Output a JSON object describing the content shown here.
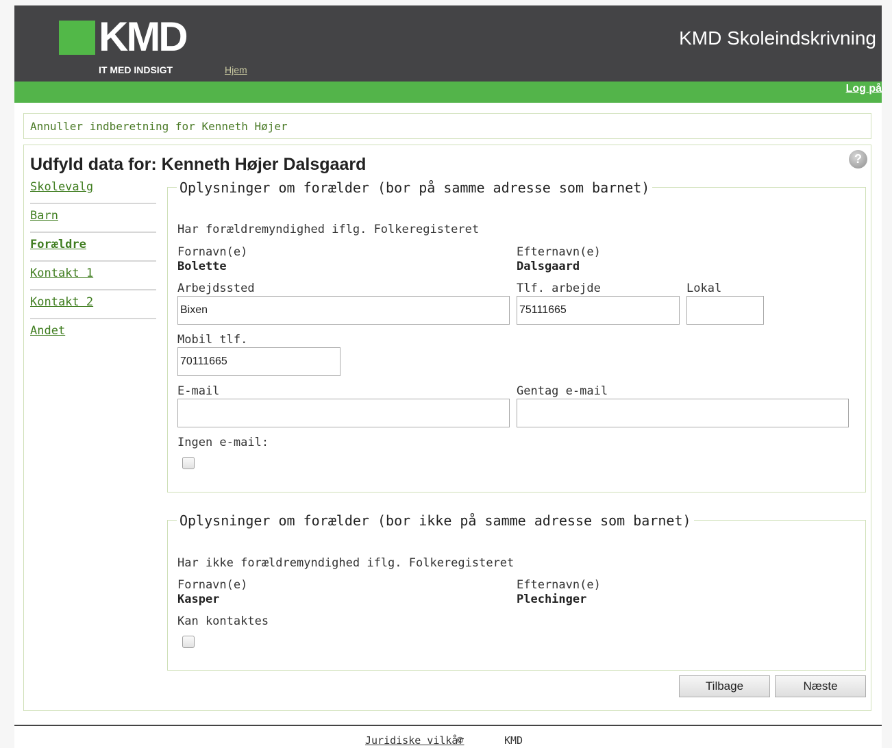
{
  "header": {
    "logo_text": "KMD",
    "tagline": "IT MED INDSIGT",
    "home_link": "Hjem",
    "app_title": "KMD Skoleindskrivning",
    "login_link": "Log på"
  },
  "cancel_link": "Annuller indberetning for Kenneth Højer",
  "page_title": "Udfyld data for: Kenneth Højer Dalsgaard",
  "help_icon": "?",
  "sidebar": {
    "items": [
      {
        "label": "Skolevalg"
      },
      {
        "label": "Barn"
      },
      {
        "label": "Forældre",
        "active": true
      },
      {
        "label": "Kontakt 1"
      },
      {
        "label": "Kontakt 2"
      },
      {
        "label": "Andet"
      }
    ]
  },
  "parent1": {
    "legend": "Oplysninger om forælder (bor på samme adresse som barnet)",
    "custody_text": "Har forældremyndighed iflg. Folkeregisteret",
    "first_name_label": "Fornavn(e)",
    "first_name": "Bolette",
    "last_name_label": "Efternavn(e)",
    "last_name": "Dalsgaard",
    "workplace_label": "Arbejdssted",
    "workplace": "Bixen",
    "work_phone_label": "Tlf. arbejde",
    "work_phone": "75111665",
    "extension_label": "Lokal",
    "extension": "",
    "mobile_label": "Mobil tlf.",
    "mobile": "70111665",
    "email_label": "E-mail",
    "email": "",
    "email_repeat_label": "Gentag e-mail",
    "email_repeat": "",
    "no_email_label": "Ingen e-mail:",
    "no_email_checked": false
  },
  "parent2": {
    "legend": "Oplysninger om forælder (bor ikke på samme adresse som barnet)",
    "custody_text": "Har ikke forældremyndighed iflg. Folkeregisteret",
    "first_name_label": "Fornavn(e)",
    "first_name": "Kasper",
    "last_name_label": "Efternavn(e)",
    "last_name": "Plechinger",
    "can_contact_label": "Kan kontaktes",
    "can_contact_checked": false
  },
  "buttons": {
    "back": "Tilbage",
    "next": "Næste"
  },
  "footer": {
    "terms_link": "Juridiske vilkår",
    "copyright": "©",
    "company": "KMD"
  }
}
